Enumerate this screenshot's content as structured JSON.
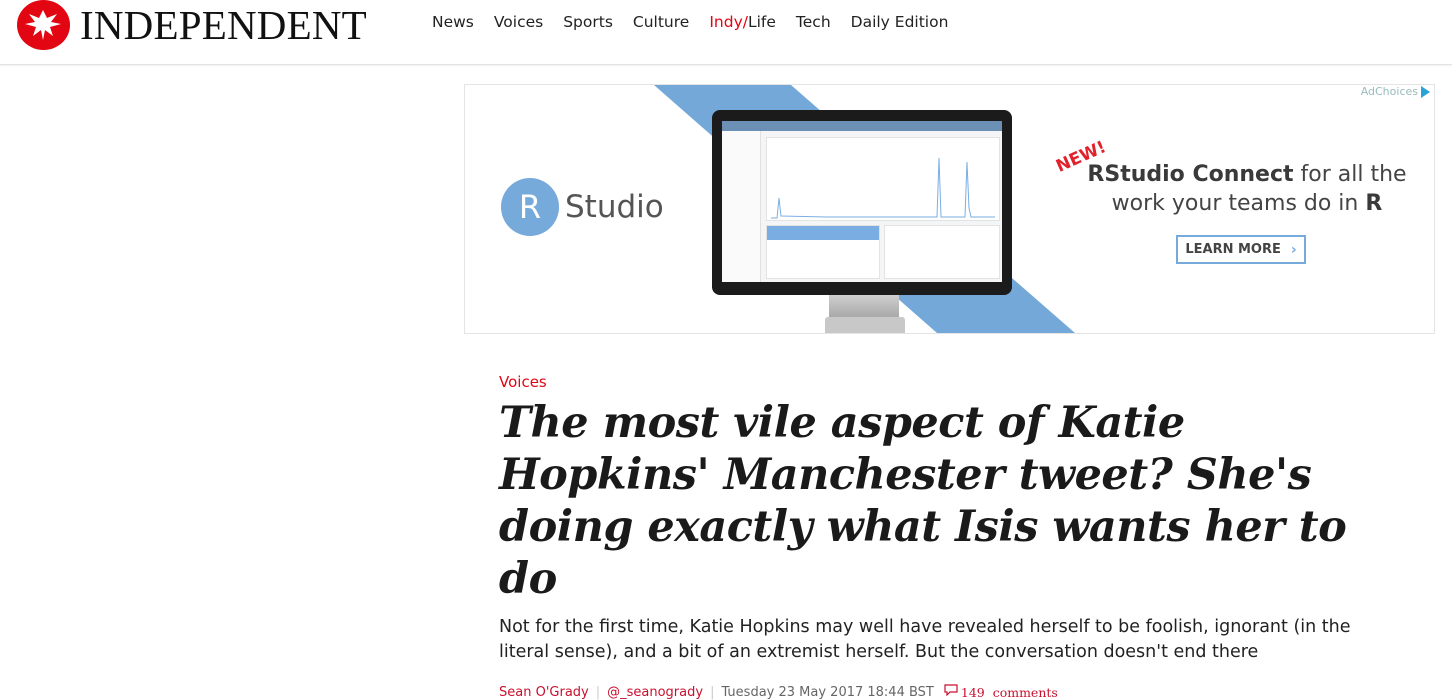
{
  "site": {
    "logo_text": "INDEPENDENT"
  },
  "nav": {
    "items": [
      {
        "label": "News"
      },
      {
        "label": "Voices"
      },
      {
        "label": "Sports"
      },
      {
        "label": "Culture"
      },
      {
        "label_a": "Indy/",
        "label_b": "Life"
      },
      {
        "label": "Tech"
      },
      {
        "label": "Daily Edition"
      }
    ]
  },
  "ad": {
    "adchoices": "AdChoices",
    "logo_letter": "R",
    "logo_word": "Studio",
    "new_badge": "NEW!",
    "headline_bold": "RStudio Connect",
    "headline_rest": " for all the work your teams do in ",
    "headline_end": "R",
    "button_label": "LEARN MORE",
    "colors": {
      "brand": "#75aadb",
      "stripe": "#74a8d8",
      "badge": "#e0232b"
    }
  },
  "article": {
    "section": "Voices",
    "headline": "The most vile aspect of Katie Hopkins' Manchester tweet? She's doing exactly what Isis wants her to do",
    "standfirst": "Not for the first time, Katie Hopkins may well have revealed herself to be foolish, ignorant (in the literal sense), and a bit of an extremist herself. But the conversation doesn't end there",
    "author": "Sean O'Grady",
    "handle": "@_seanogrady",
    "date": "Tuesday 23 May 2017 18:44 BST",
    "comment_count": "149",
    "comments_label": "comments"
  },
  "colors": {
    "accent": "#e20613"
  }
}
